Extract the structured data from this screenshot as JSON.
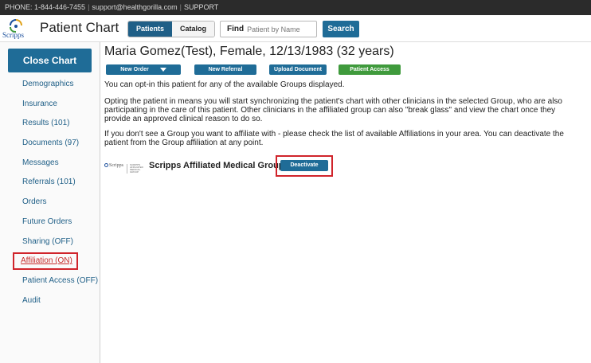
{
  "topbar": {
    "phone": "PHONE: 1-844-446-7455",
    "email": "support@healthgorilla.com",
    "support": "SUPPORT"
  },
  "header": {
    "logo_text": "Scripps",
    "app_title": "Patient Chart",
    "tabs": [
      {
        "label": "Patients",
        "active": true
      },
      {
        "label": "Catalog",
        "active": false
      }
    ],
    "find_label": "Find",
    "find_placeholder": "Patient by Name",
    "search_label": "Search"
  },
  "sidebar": {
    "close_chart": "Close Chart",
    "items": [
      {
        "label": "Demographics"
      },
      {
        "label": "Insurance"
      },
      {
        "label": "Results (101)"
      },
      {
        "label": "Documents (97)"
      },
      {
        "label": "Messages"
      },
      {
        "label": "Referrals (101)"
      },
      {
        "label": "Orders"
      },
      {
        "label": "Future Orders"
      },
      {
        "label": "Sharing (OFF)"
      },
      {
        "label": "Affiliation (ON)",
        "highlighted": true
      },
      {
        "label": "Patient Access (OFF)"
      },
      {
        "label": "Audit"
      }
    ]
  },
  "main": {
    "patient_name": "Maria Gomez(Test), Female, 12/13/1983 (32 years)",
    "actions": {
      "new_order": "New Order",
      "new_referral": "New Referral",
      "upload_document": "Upload Document",
      "patient_access": "Patient Access"
    },
    "para1": "You can opt-in this patient for any of the available Groups displayed.",
    "para2": "Opting the patient in means you will start synchronizing the patient's chart with other clinicians in the selected Group, who are also participating in the care of this patient. Other clinicians in the affiliated group can also \"break glass\" and view the chart once they provide an approved clinical reason to do so.",
    "para3": "If you don't see a Group you want to affiliate with - please check the list of available Affiliations in your area. You can deactivate the patient from the Group affiliation at any point.",
    "group": {
      "logo_text": "Scripps",
      "logo2_text": "SCRIPPS AFFILIATED MEDICAL GROUP",
      "name": "Scripps Affiliated Medical Group",
      "deactivate": "Deactivate"
    }
  },
  "colors": {
    "primary": "#1f6c97",
    "green": "#3f9a3c",
    "highlight": "#d0242b",
    "topbar": "#2b2b2b"
  }
}
